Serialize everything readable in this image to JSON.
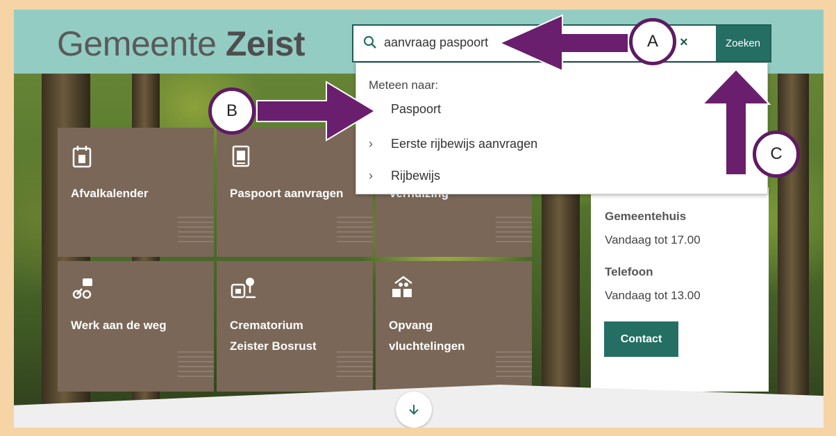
{
  "site": {
    "logo_light": "Gemeente ",
    "logo_bold": "Zeist"
  },
  "search": {
    "value": "aanvraag paspoort",
    "clear_symbol": "×",
    "button_label": "Zoeken"
  },
  "suggestions": {
    "title": "Meteen naar:",
    "items": [
      {
        "label": "Paspoort"
      },
      {
        "label": "Eerste rijbewijs aanvragen"
      },
      {
        "label": "Rijbewijs"
      }
    ]
  },
  "tiles": [
    {
      "label": "Afvalkalender",
      "icon": "calendar-bin-icon"
    },
    {
      "label": "Paspoort aanvragen",
      "icon": "passport-icon"
    },
    {
      "label": "Verhuizing",
      "icon": "moving-icon"
    },
    {
      "label": "Werk aan de weg",
      "icon": "roadwork-icon"
    },
    {
      "label_line1": "Crematorium",
      "label_line2": "Zeister Bosrust",
      "icon": "crematorium-icon"
    },
    {
      "label_line1": "Opvang",
      "label_line2": "vluchtelingen",
      "icon": "refugee-shelter-icon"
    }
  ],
  "info": {
    "gemeentehuis_label": "Gemeentehuis",
    "gemeentehuis_hours": "Vandaag tot 17.00",
    "telefoon_label": "Telefoon",
    "telefoon_hours": "Vandaag tot 13.00",
    "contact_label": "Contact"
  },
  "annotations": [
    {
      "label": "A"
    },
    {
      "label": "B"
    },
    {
      "label": "C"
    }
  ],
  "colors": {
    "header": "#93ccc3",
    "accent": "#256e64",
    "tile": "#7a6757",
    "annotation": "#6a1e6e",
    "frame": "#f6d4a6"
  }
}
